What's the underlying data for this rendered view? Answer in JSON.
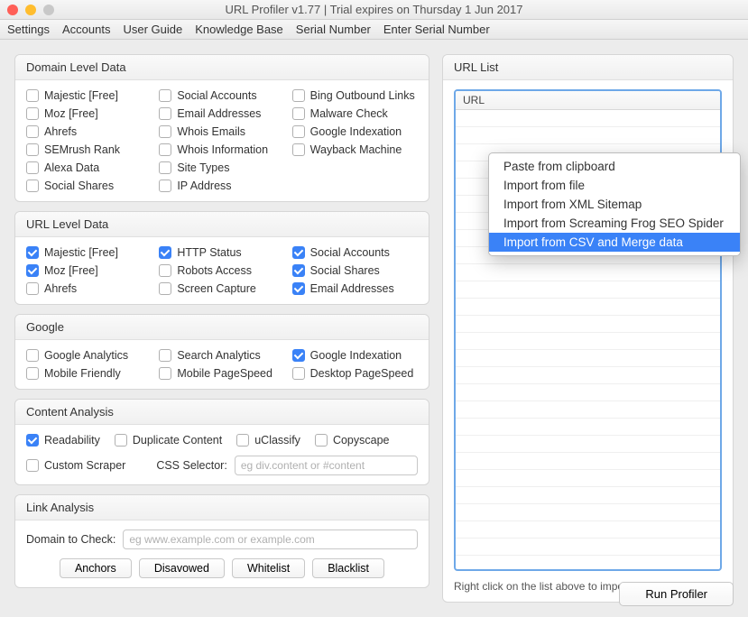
{
  "window": {
    "title": "URL Profiler v1.77 | Trial expires on Thursday 1 Jun 2017"
  },
  "menubar": [
    "Settings",
    "Accounts",
    "User Guide",
    "Knowledge Base",
    "Serial Number",
    "Enter Serial Number"
  ],
  "panels": {
    "domainLevel": {
      "title": "Domain Level Data",
      "items": [
        {
          "label": "Majestic [Free]",
          "checked": false
        },
        {
          "label": "Social Accounts",
          "checked": false
        },
        {
          "label": "Bing Outbound Links",
          "checked": false
        },
        {
          "label": "Moz [Free]",
          "checked": false
        },
        {
          "label": "Email Addresses",
          "checked": false
        },
        {
          "label": "Malware Check",
          "checked": false
        },
        {
          "label": "Ahrefs",
          "checked": false
        },
        {
          "label": "Whois Emails",
          "checked": false
        },
        {
          "label": "Google Indexation",
          "checked": false
        },
        {
          "label": "SEMrush Rank",
          "checked": false
        },
        {
          "label": "Whois Information",
          "checked": false
        },
        {
          "label": "Wayback Machine",
          "checked": false
        },
        {
          "label": "Alexa Data",
          "checked": false
        },
        {
          "label": "Site Types",
          "checked": false
        },
        {
          "label": "",
          "checked": false,
          "blank": true
        },
        {
          "label": "Social Shares",
          "checked": false
        },
        {
          "label": "IP Address",
          "checked": false
        }
      ]
    },
    "urlLevel": {
      "title": "URL Level Data",
      "items": [
        {
          "label": "Majestic [Free]",
          "checked": true
        },
        {
          "label": "HTTP Status",
          "checked": true
        },
        {
          "label": "Social Accounts",
          "checked": true
        },
        {
          "label": "Moz [Free]",
          "checked": true
        },
        {
          "label": "Robots Access",
          "checked": false
        },
        {
          "label": "Social Shares",
          "checked": true
        },
        {
          "label": "Ahrefs",
          "checked": false
        },
        {
          "label": "Screen Capture",
          "checked": false
        },
        {
          "label": "Email Addresses",
          "checked": true
        }
      ]
    },
    "google": {
      "title": "Google",
      "items": [
        {
          "label": "Google Analytics",
          "checked": false
        },
        {
          "label": "Search Analytics",
          "checked": false
        },
        {
          "label": "Google Indexation",
          "checked": true
        },
        {
          "label": "Mobile Friendly",
          "checked": false
        },
        {
          "label": "Mobile PageSpeed",
          "checked": false
        },
        {
          "label": "Desktop PageSpeed",
          "checked": false
        }
      ]
    },
    "contentAnalysis": {
      "title": "Content Analysis",
      "items": [
        {
          "label": "Readability",
          "checked": true
        },
        {
          "label": "Duplicate Content",
          "checked": false
        },
        {
          "label": "uClassify",
          "checked": false
        },
        {
          "label": "Copyscape",
          "checked": false
        }
      ],
      "customScraper": {
        "label": "Custom Scraper",
        "checked": false
      },
      "cssSelectorLabel": "CSS Selector:",
      "cssSelectorPlaceholder": "eg div.content or #content"
    },
    "linkAnalysis": {
      "title": "Link Analysis",
      "domainLabel": "Domain to Check:",
      "domainPlaceholder": "eg www.example.com or example.com",
      "buttons": [
        "Anchors",
        "Disavowed",
        "Whitelist",
        "Blacklist"
      ]
    },
    "urlList": {
      "title": "URL List",
      "column": "URL",
      "hint": "Right click on the list above to import or add URLs"
    }
  },
  "contextMenu": {
    "items": [
      "Paste from clipboard",
      "Import from file",
      "Import from XML Sitemap",
      "Import from Screaming Frog SEO Spider",
      "Import from CSV and Merge data"
    ],
    "highlightedIndex": 4
  },
  "runButton": "Run Profiler"
}
